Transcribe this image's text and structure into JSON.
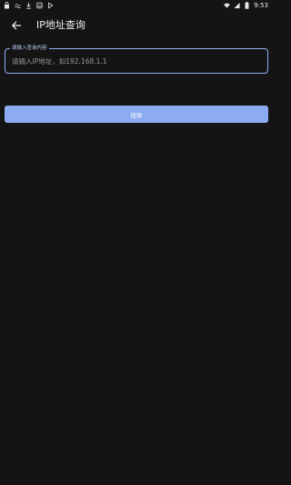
{
  "status_bar": {
    "time": "9:53",
    "left_icons": [
      "lock-badge-icon",
      "wave-icon",
      "download-icon",
      "image-icon",
      "play-icon"
    ],
    "right_icons": [
      "wifi-icon",
      "signal-icon",
      "battery-icon"
    ]
  },
  "toolbar": {
    "back_icon": "arrow-left-icon",
    "title": "IP地址查询"
  },
  "search": {
    "label": "请输入查询内容",
    "placeholder": "请输入IP地址，如192.168.1.1",
    "value": ""
  },
  "actions": {
    "search_label": "搜索"
  },
  "colors": {
    "background": "#141414",
    "accent": "#8cabf2",
    "outline": "#8fb0f5",
    "text": "#ffffff"
  }
}
